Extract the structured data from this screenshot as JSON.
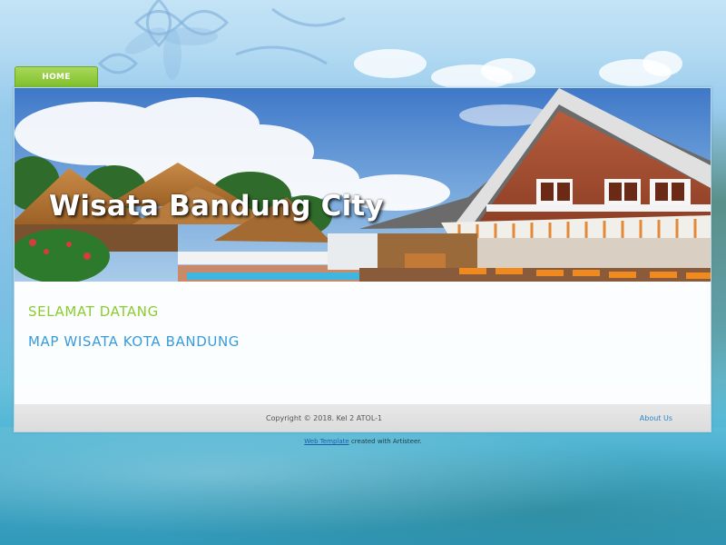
{
  "nav": {
    "tabs": [
      {
        "label": "HOME"
      }
    ]
  },
  "header": {
    "headline": "Wisata Bandung City"
  },
  "content": {
    "welcome_heading": "SELAMAT DATANG",
    "map_heading": "MAP WISATA KOTA BANDUNG"
  },
  "footer": {
    "copyright": "Copyright © 2018. Kel 2 ATOL-1",
    "about_link": "About Us"
  },
  "credit": {
    "link_text": "Web Template",
    "suffix": "created with Artisteer."
  },
  "colors": {
    "nav_green": "#8cc63f",
    "welcome_green": "#8ccc2e",
    "heading_blue": "#3a9bdc",
    "link_blue": "#2d86c9"
  },
  "icons": {
    "header_image": "resort-photo"
  }
}
